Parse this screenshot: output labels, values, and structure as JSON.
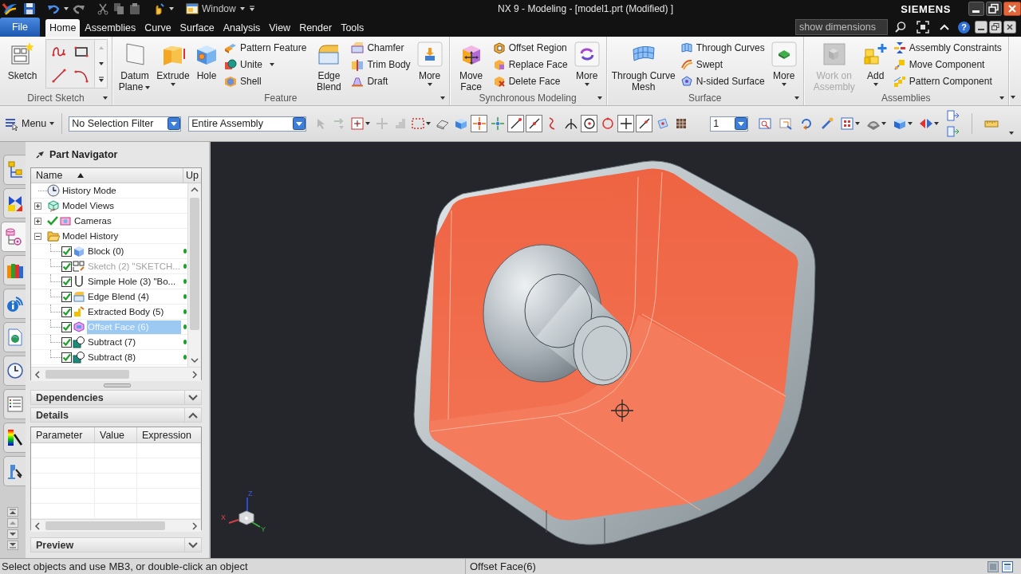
{
  "title_bar": {
    "window_menu": "Window",
    "title": "NX 9 - Modeling - [model1.prt (Modified) ]",
    "brand": "SIEMENS"
  },
  "ribbon_tabs": {
    "file": "File",
    "tabs": [
      {
        "label": "Home",
        "selected": true
      },
      {
        "label": "Assemblies",
        "selected": false
      },
      {
        "label": "Curve",
        "selected": false
      },
      {
        "label": "Surface",
        "selected": false
      },
      {
        "label": "Analysis",
        "selected": false
      },
      {
        "label": "View",
        "selected": false
      },
      {
        "label": "Render",
        "selected": false
      },
      {
        "label": "Tools",
        "selected": false
      }
    ],
    "command_finder": {
      "value": "show dimensions"
    },
    "help": "?"
  },
  "ribbon": {
    "groups": [
      {
        "label": "Direct Sketch",
        "items": [
          {
            "kind": "large",
            "label": "Sketch",
            "dropdown": false,
            "disabled": false
          },
          {
            "kind": "gallery"
          }
        ]
      },
      {
        "label": "Feature",
        "items": [
          {
            "kind": "large",
            "label": "Datum Plane",
            "dropdown": true,
            "disabled": false
          },
          {
            "kind": "large",
            "label": "Extrude",
            "dropdown": true,
            "disabled": false
          },
          {
            "kind": "large",
            "label": "Hole",
            "dropdown": false,
            "disabled": false
          },
          {
            "kind": "stack",
            "buttons": [
              {
                "label": "Pattern Feature",
                "dropdown": false
              },
              {
                "label": "Unite",
                "dropdown": true
              },
              {
                "label": "Shell",
                "dropdown": false
              }
            ]
          },
          {
            "kind": "large",
            "label": "Edge Blend",
            "dropdown": false,
            "disabled": false
          },
          {
            "kind": "stack",
            "buttons": [
              {
                "label": "Chamfer",
                "dropdown": false
              },
              {
                "label": "Trim Body",
                "dropdown": false
              },
              {
                "label": "Draft",
                "dropdown": false
              }
            ]
          },
          {
            "kind": "large",
            "label": "More",
            "dropdown": true,
            "disabled": false
          }
        ]
      },
      {
        "label": "Synchronous Modeling",
        "items": [
          {
            "kind": "large",
            "label": "Move Face",
            "dropdown": false,
            "disabled": false
          },
          {
            "kind": "stack",
            "buttons": [
              {
                "label": "Offset Region",
                "dropdown": false
              },
              {
                "label": "Replace Face",
                "dropdown": false
              },
              {
                "label": "Delete Face",
                "dropdown": false
              }
            ]
          },
          {
            "kind": "large",
            "label": "More",
            "dropdown": true,
            "disabled": false
          }
        ]
      },
      {
        "label": "Surface",
        "items": [
          {
            "kind": "large",
            "label": "Through Curve Mesh",
            "dropdown": false,
            "disabled": false
          },
          {
            "kind": "stack",
            "buttons": [
              {
                "label": "Through Curves",
                "dropdown": false
              },
              {
                "label": "Swept",
                "dropdown": false
              },
              {
                "label": "N-sided Surface",
                "dropdown": false
              }
            ]
          },
          {
            "kind": "large",
            "label": "More",
            "dropdown": true,
            "disabled": false
          }
        ]
      },
      {
        "label": "Assemblies",
        "items": [
          {
            "kind": "large",
            "label": "Work on Assembly",
            "dropdown": false,
            "disabled": true
          },
          {
            "kind": "large",
            "label": "Add",
            "dropdown": true,
            "disabled": false
          },
          {
            "kind": "stack",
            "buttons": [
              {
                "label": "Assembly Constraints",
                "dropdown": false
              },
              {
                "label": "Move Component",
                "dropdown": false
              },
              {
                "label": "Pattern Component",
                "dropdown": false
              }
            ]
          }
        ]
      }
    ]
  },
  "toolbar": {
    "menu": "Menu",
    "selection_filter": "No Selection Filter",
    "assembly_scope": "Entire Assembly",
    "snap_tools": [
      {
        "disabled": true,
        "on": false,
        "dropdown": false
      },
      {
        "disabled": true,
        "on": false,
        "dropdown": false
      },
      {
        "disabled": false,
        "on": false,
        "dropdown": true
      },
      {
        "disabled": true,
        "on": false,
        "dropdown": false
      },
      {
        "disabled": true,
        "on": false,
        "dropdown": false
      },
      {
        "disabled": false,
        "on": false,
        "dropdown": true
      },
      {
        "disabled": false,
        "on": false,
        "dropdown": false
      },
      {
        "disabled": false,
        "on": false,
        "dropdown": false
      },
      {
        "disabled": false,
        "on": true,
        "dropdown": false
      },
      {
        "disabled": false,
        "on": false,
        "dropdown": false
      },
      {
        "disabled": false,
        "on": true,
        "dropdown": false
      },
      {
        "disabled": false,
        "on": true,
        "dropdown": false
      },
      {
        "disabled": false,
        "on": false,
        "dropdown": false
      },
      {
        "disabled": false,
        "on": false,
        "dropdown": false
      },
      {
        "disabled": false,
        "on": true,
        "dropdown": false
      },
      {
        "disabled": false,
        "on": false,
        "dropdown": false
      },
      {
        "disabled": false,
        "on": true,
        "dropdown": false
      },
      {
        "disabled": false,
        "on": true,
        "dropdown": false
      },
      {
        "disabled": false,
        "on": false,
        "dropdown": false
      },
      {
        "disabled": false,
        "on": false,
        "dropdown": false
      }
    ],
    "layer": "1",
    "view_tools": [
      {
        "disabled": false,
        "on": false,
        "dropdown": false
      },
      {
        "disabled": false,
        "on": false,
        "dropdown": false
      },
      {
        "disabled": false,
        "on": false,
        "dropdown": false
      },
      {
        "disabled": false,
        "on": false,
        "dropdown": false
      },
      {
        "disabled": false,
        "on": false,
        "dropdown": true
      },
      {
        "disabled": false,
        "on": false,
        "dropdown": true
      },
      {
        "disabled": false,
        "on": false,
        "dropdown": true
      },
      {
        "disabled": false,
        "on": false,
        "dropdown": true
      },
      {
        "disabled": false,
        "on": false,
        "dropdown": false
      },
      {
        "disabled": false,
        "on": false,
        "dropdown": false
      },
      {
        "disabled": false,
        "on": false,
        "dropdown": false
      }
    ]
  },
  "resource_bar": {
    "tabs": [
      {
        "selected": false
      },
      {
        "selected": false
      },
      {
        "selected": true
      },
      {
        "selected": false
      },
      {
        "selected": false
      },
      {
        "selected": false
      },
      {
        "selected": false
      },
      {
        "selected": false
      },
      {
        "selected": false
      },
      {
        "selected": false
      }
    ]
  },
  "part_navigator": {
    "title": "Part Navigator",
    "columns": [
      "Name",
      "Up"
    ],
    "tree": [
      {
        "label": "History Mode",
        "kind": "history",
        "checked": false,
        "selected": false
      },
      {
        "label": "Model Views",
        "kind": "views",
        "expanded": false,
        "checked": false,
        "selected": false
      },
      {
        "label": "Cameras",
        "kind": "cameras",
        "expanded": false,
        "checked": true,
        "selected": false
      },
      {
        "label": "Model History",
        "kind": "folder",
        "expanded": true,
        "checked": false,
        "selected": false,
        "children": [
          {
            "label": "Block (0)",
            "kind": "block",
            "checked": true,
            "selected": false,
            "disabled": false,
            "up_to_date": true
          },
          {
            "label": "Sketch (2) \"SKETCH...",
            "kind": "sketch",
            "checked": true,
            "selected": false,
            "disabled": true,
            "up_to_date": true
          },
          {
            "label": "Simple Hole (3) \"Bo...",
            "kind": "hole",
            "checked": true,
            "selected": false,
            "disabled": false,
            "up_to_date": true
          },
          {
            "label": "Edge Blend (4)",
            "kind": "blend",
            "checked": true,
            "selected": false,
            "disabled": false,
            "up_to_date": true
          },
          {
            "label": "Extracted Body (5)",
            "kind": "extract",
            "checked": true,
            "selected": false,
            "disabled": false,
            "up_to_date": true
          },
          {
            "label": "Offset Face (6)",
            "kind": "offset",
            "checked": true,
            "selected": true,
            "disabled": false,
            "up_to_date": true
          },
          {
            "label": "Subtract (7)",
            "kind": "subtract",
            "checked": true,
            "selected": false,
            "disabled": false,
            "up_to_date": true
          },
          {
            "label": "Subtract (8)",
            "kind": "subtract",
            "checked": true,
            "selected": false,
            "disabled": false,
            "up_to_date": true
          }
        ]
      }
    ],
    "sections": [
      {
        "title": "Dependencies",
        "expanded": false
      },
      {
        "title": "Details",
        "expanded": true,
        "columns": [
          "Parameter",
          "Value",
          "Expression"
        ]
      },
      {
        "title": "Preview",
        "expanded": false
      }
    ]
  },
  "viewport": {
    "triad": {
      "x": "X",
      "y": "Y",
      "z": "Z"
    }
  },
  "status_bar": {
    "prompt": "Select objects and use MB3, or double-click an object",
    "selection": "Offset Face(6)"
  }
}
